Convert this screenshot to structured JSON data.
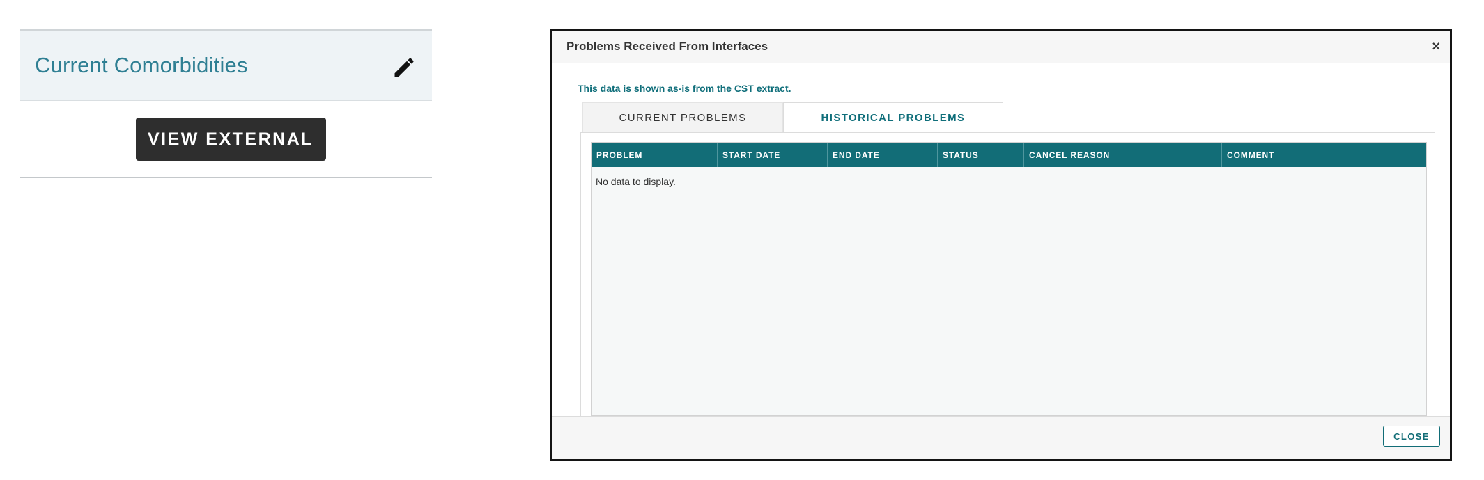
{
  "comorbidities": {
    "title": "Current Comorbidities",
    "edit_icon": "pencil-icon",
    "view_external_label": "VIEW EXTERNAL"
  },
  "modal": {
    "title": "Problems Received From Interfaces",
    "close_symbol": "×",
    "notice": "This data is shown as-is from the CST extract.",
    "tabs": [
      {
        "label": "CURRENT PROBLEMS",
        "active": false
      },
      {
        "label": "HISTORICAL PROBLEMS",
        "active": true
      }
    ],
    "table": {
      "columns": [
        "PROBLEM",
        "START DATE",
        "END DATE",
        "STATUS",
        "CANCEL REASON",
        "COMMENT"
      ],
      "empty_message": "No data to display."
    },
    "close_button_label": "CLOSE"
  },
  "colors": {
    "accent_teal": "#126d77",
    "title_teal": "#2f7f93",
    "dark_button": "#2e2e2e"
  }
}
